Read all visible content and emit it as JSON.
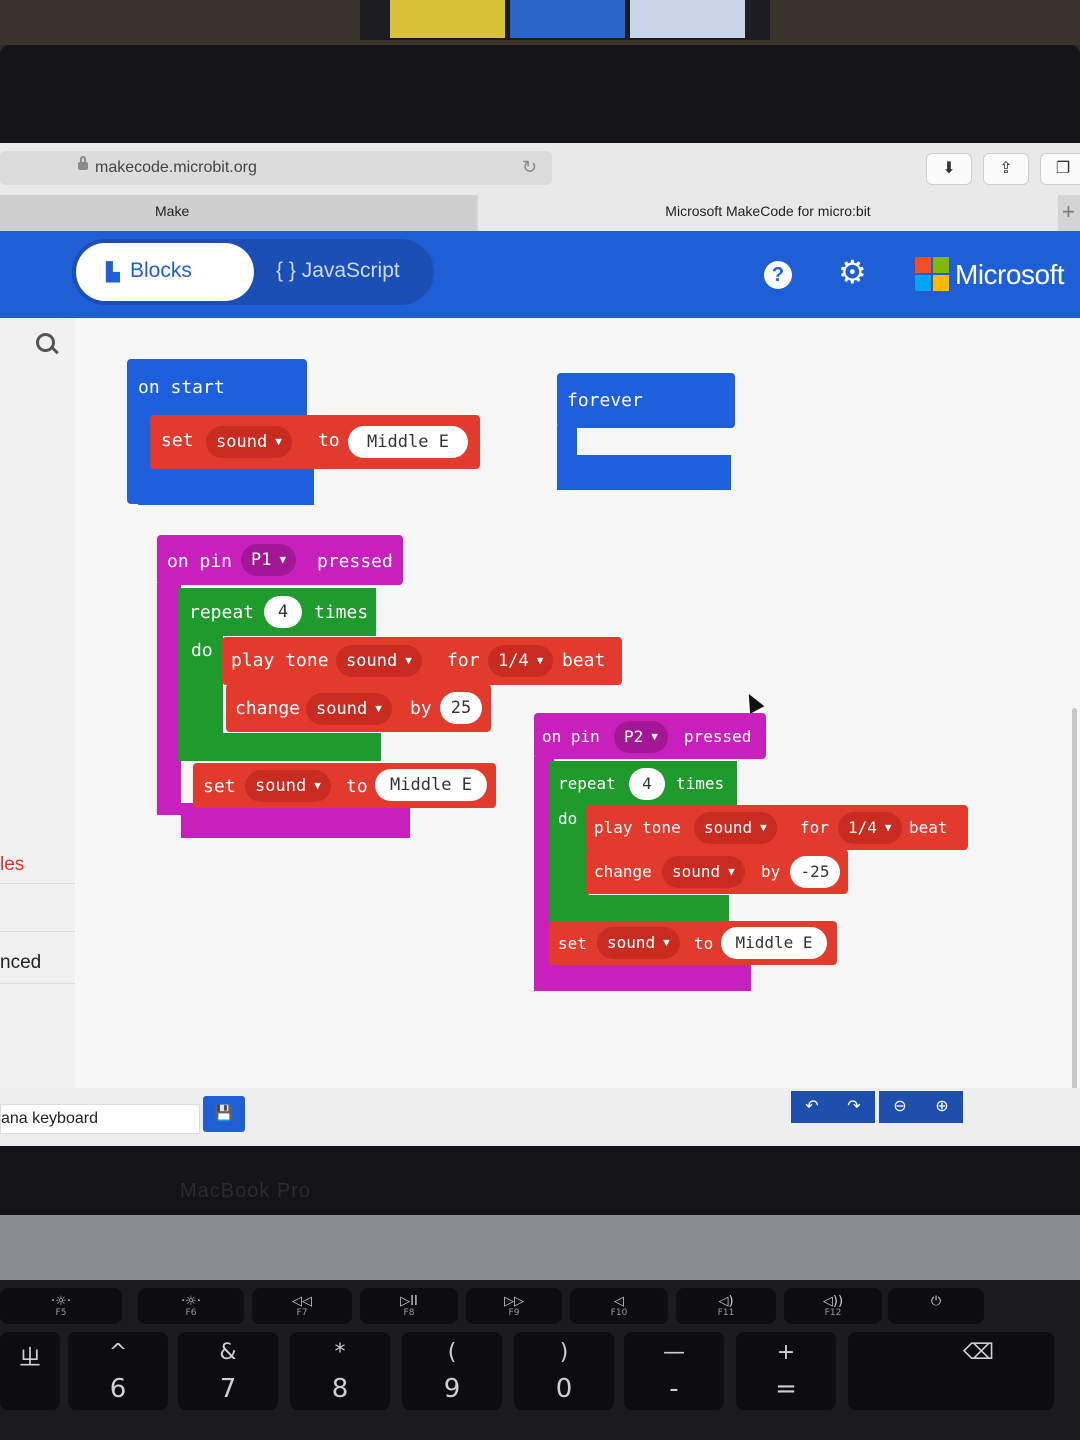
{
  "browser": {
    "url": "makecode.microbit.org",
    "tabs": [
      {
        "label": "Make"
      },
      {
        "label": "Microsoft MakeCode for micro:bit"
      }
    ]
  },
  "header": {
    "blocks_label": "Blocks",
    "javascript_label": "{ } JavaScript",
    "brand": "Microsoft"
  },
  "toolbox": {
    "partial_items": [
      "les",
      "nced"
    ]
  },
  "project": {
    "name_partial": "ana keyboard"
  },
  "blocks": {
    "on_start": {
      "label": "on start",
      "set": "set",
      "var": "sound",
      "to": "to",
      "value": "Middle E"
    },
    "forever": {
      "label": "forever"
    },
    "pin1": {
      "on_pin": "on pin",
      "pin": "P1",
      "pressed": "pressed",
      "repeat": "repeat",
      "count": "4",
      "times": "times",
      "do": "do",
      "play_tone": "play tone",
      "tone_var": "sound",
      "for": "for",
      "beat_val": "1/4",
      "beat": "beat",
      "change": "change",
      "change_var": "sound",
      "by": "by",
      "delta": "25",
      "set": "set",
      "set_var": "sound",
      "to": "to",
      "set_val": "Middle E"
    },
    "pin2": {
      "on_pin": "on pin",
      "pin": "P2",
      "pressed": "pressed",
      "repeat": "repeat",
      "count": "4",
      "times": "times",
      "do": "do",
      "play_tone": "play tone",
      "tone_var": "sound",
      "for": "for",
      "beat_val": "1/4",
      "beat": "beat",
      "change": "change",
      "change_var": "sound",
      "by": "by",
      "delta": "-25",
      "set": "set",
      "set_var": "sound",
      "to": "to",
      "set_val": "Middle E"
    }
  },
  "keyboard": {
    "fkeys": [
      {
        "top": "·☼·",
        "bottom": "F5"
      },
      {
        "top": "·☼·",
        "bottom": "F6"
      },
      {
        "top": "◁◁",
        "bottom": "F7"
      },
      {
        "top": "▷II",
        "bottom": "F8"
      },
      {
        "top": "▷▷",
        "bottom": "F9"
      },
      {
        "top": "◁",
        "bottom": "F10"
      },
      {
        "top": "◁)",
        "bottom": "F11"
      },
      {
        "top": "◁))",
        "bottom": "F12"
      },
      {
        "top": "⏻",
        "bottom": ""
      }
    ],
    "numkeys": [
      {
        "top": "ㄓ",
        "bottom": ""
      },
      {
        "top": "^",
        "bottom": "6"
      },
      {
        "top": "&",
        "bottom": "7"
      },
      {
        "top": "*",
        "bottom": "8"
      },
      {
        "top": "(",
        "bottom": "9"
      },
      {
        "top": ")",
        "bottom": "0"
      },
      {
        "top": "—",
        "bottom": "-"
      },
      {
        "top": "+",
        "bottom": "="
      },
      {
        "top": "⌫",
        "bottom": ""
      }
    ]
  },
  "bezel_brand": "MacBook Pro",
  "colors": {
    "header": "#1f5fd6",
    "event_block": "#c81fbd",
    "loop_block": "#1f9a2d",
    "music_block": "#e33a2e",
    "basic_block": "#1e5fde"
  }
}
